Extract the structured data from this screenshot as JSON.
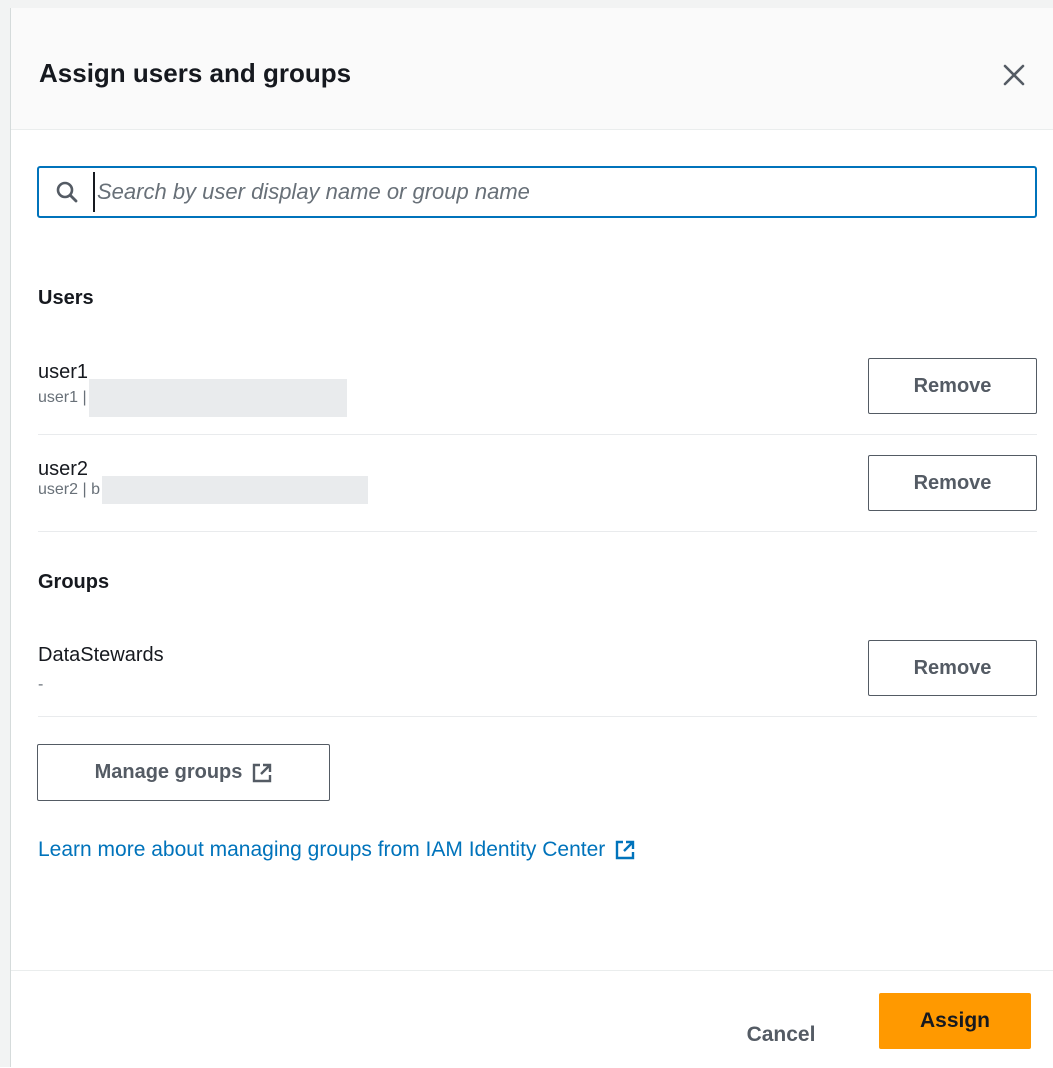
{
  "dialog": {
    "title": "Assign users and groups"
  },
  "search": {
    "placeholder": "Search by user display name or group name",
    "value": ""
  },
  "users_section": {
    "title": "Users"
  },
  "users": [
    {
      "name": "user1",
      "sub": "user1 |"
    },
    {
      "name": "user2",
      "sub": "user2 | b"
    }
  ],
  "groups_section": {
    "title": "Groups"
  },
  "groups": [
    {
      "name": "DataStewards",
      "sub": "-"
    }
  ],
  "buttons": {
    "remove": "Remove",
    "manage_groups": "Manage groups",
    "cancel": "Cancel",
    "assign": "Assign"
  },
  "link": {
    "text": "Learn more about managing groups from IAM Identity Center"
  },
  "colors": {
    "primary": "#ff9900",
    "link": "#0073bb",
    "text": "#16191f",
    "secondary_text": "#687078"
  },
  "icons": {
    "close": "close-icon",
    "search": "search-icon",
    "external": "external-link-icon"
  }
}
